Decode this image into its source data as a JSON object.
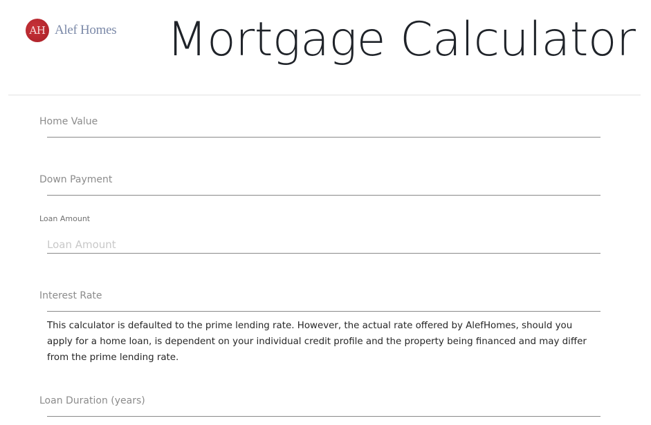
{
  "header": {
    "logo_monogram": "AH",
    "logo_text": "Alef Homes",
    "title": "Mortgage Calculator"
  },
  "fields": {
    "home_value": {
      "label": "Home Value",
      "value": ""
    },
    "down_payment": {
      "label": "Down Payment",
      "value": ""
    },
    "loan_amount": {
      "label": "Loan Amount",
      "value": "",
      "placeholder": "Loan Amount"
    },
    "interest_rate": {
      "label": "Interest Rate",
      "value": ""
    },
    "loan_duration": {
      "label": "Loan Duration (years)",
      "value": ""
    }
  },
  "interest_note": "This calculator is defaulted to the prime lending rate. However, the actual rate offered by AlefHomes, should you apply for a home loan, is dependent on your individual credit profile and the property being financed and may differ from the prime lending rate.",
  "colors": {
    "brand_red": "#b3252d",
    "logo_text": "#7b89a8",
    "title_text": "#1f2329",
    "underline": "#888888"
  }
}
